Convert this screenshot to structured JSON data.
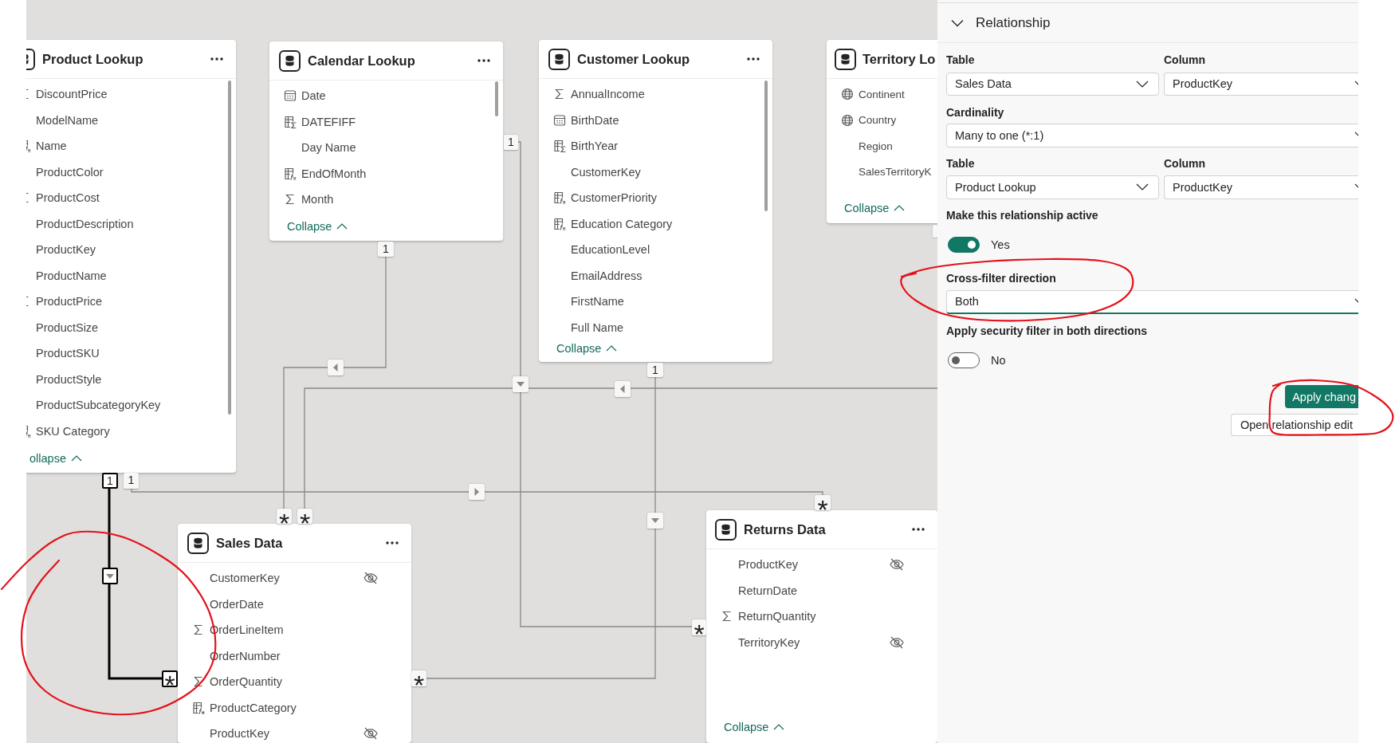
{
  "cards": [
    {
      "title": "Product Lookup",
      "fields": [
        {
          "name": "DiscountPrice",
          "kind": "sum",
          "hidden": false
        },
        {
          "name": "ModelName",
          "kind": "plain",
          "hidden": false
        },
        {
          "name": "Name",
          "kind": "calc",
          "hidden": false
        },
        {
          "name": "ProductColor",
          "kind": "plain",
          "hidden": false
        },
        {
          "name": "ProductCost",
          "kind": "sum",
          "hidden": false
        },
        {
          "name": "ProductDescription",
          "kind": "plain",
          "hidden": false
        },
        {
          "name": "ProductKey",
          "kind": "plain",
          "hidden": false
        },
        {
          "name": "ProductName",
          "kind": "plain",
          "hidden": false
        },
        {
          "name": "ProductPrice",
          "kind": "sum",
          "hidden": false
        },
        {
          "name": "ProductSize",
          "kind": "plain",
          "hidden": false
        },
        {
          "name": "ProductSKU",
          "kind": "plain",
          "hidden": false
        },
        {
          "name": "ProductStyle",
          "kind": "plain",
          "hidden": false
        },
        {
          "name": "ProductSubcategoryKey",
          "kind": "plain",
          "hidden": false
        },
        {
          "name": "SKU Category",
          "kind": "calc",
          "hidden": false
        }
      ],
      "collapse_label": "ollapse"
    },
    {
      "title": "Calendar Lookup",
      "fields": [
        {
          "name": "Date",
          "kind": "date",
          "hidden": false
        },
        {
          "name": "DATEFIFF",
          "kind": "calc_sum",
          "hidden": false
        },
        {
          "name": "Day Name",
          "kind": "plain",
          "hidden": false
        },
        {
          "name": "EndOfMonth",
          "kind": "calc",
          "hidden": false
        },
        {
          "name": "Month",
          "kind": "sum",
          "hidden": false
        }
      ],
      "collapse_label": "Collapse"
    },
    {
      "title": "Customer Lookup",
      "fields": [
        {
          "name": "AnnualIncome",
          "kind": "sum",
          "hidden": false
        },
        {
          "name": "BirthDate",
          "kind": "date",
          "hidden": false
        },
        {
          "name": "BirthYear",
          "kind": "calc_sum",
          "hidden": false
        },
        {
          "name": "CustomerKey",
          "kind": "plain",
          "hidden": false
        },
        {
          "name": "CustomerPriority",
          "kind": "calc",
          "hidden": false
        },
        {
          "name": "Education Category",
          "kind": "calc",
          "hidden": false
        },
        {
          "name": "EducationLevel",
          "kind": "plain",
          "hidden": false
        },
        {
          "name": "EmailAddress",
          "kind": "plain",
          "hidden": false
        },
        {
          "name": "FirstName",
          "kind": "plain",
          "hidden": false
        },
        {
          "name": "Full Name",
          "kind": "plain",
          "hidden": false
        }
      ],
      "collapse_label": "Collapse"
    },
    {
      "title": "Territory Lo",
      "fields": [
        {
          "name": "Continent",
          "kind": "geo",
          "hidden": false
        },
        {
          "name": "Country",
          "kind": "geo",
          "hidden": false
        },
        {
          "name": "Region",
          "kind": "plain",
          "hidden": false
        },
        {
          "name": "SalesTerritoryK",
          "kind": "plain",
          "hidden": false
        }
      ],
      "collapse_label": "Collapse"
    },
    {
      "title": "Sales Data",
      "fields": [
        {
          "name": "CustomerKey",
          "kind": "plain",
          "hidden": true
        },
        {
          "name": "OrderDate",
          "kind": "plain",
          "hidden": false
        },
        {
          "name": "OrderLineItem",
          "kind": "sum",
          "hidden": false
        },
        {
          "name": "OrderNumber",
          "kind": "plain",
          "hidden": false
        },
        {
          "name": "OrderQuantity",
          "kind": "sum",
          "hidden": false
        },
        {
          "name": "ProductCategory",
          "kind": "calc",
          "hidden": false
        },
        {
          "name": "ProductKey",
          "kind": "plain",
          "hidden": true
        }
      ]
    },
    {
      "title": "Returns Data",
      "fields": [
        {
          "name": "ProductKey",
          "kind": "plain",
          "hidden": true
        },
        {
          "name": "ReturnDate",
          "kind": "plain",
          "hidden": false
        },
        {
          "name": "ReturnQuantity",
          "kind": "sum",
          "hidden": false
        },
        {
          "name": "TerritoryKey",
          "kind": "plain",
          "hidden": true
        }
      ],
      "collapse_label": "Collapse"
    }
  ],
  "relationships": [
    {
      "one_end": "1",
      "many_end": "*",
      "selected": true
    },
    {
      "one_end": "1",
      "many_end": "*",
      "selected": false
    },
    {
      "one_end": "1",
      "many_end": "*",
      "selected": false
    },
    {
      "one_end": "1",
      "many_end": "*",
      "selected": false
    },
    {
      "one_end": "1",
      "many_end": "*",
      "selected": false
    },
    {
      "many_end": "*",
      "selected": false
    }
  ],
  "relationship_panel": {
    "title": "Relationship",
    "expanded": true,
    "from": {
      "table_label": "Table",
      "table": "Sales Data",
      "column_label": "Column",
      "column": "ProductKey"
    },
    "cardinality": {
      "label": "Cardinality",
      "value": "Many to one (*:1)"
    },
    "to": {
      "table_label": "Table",
      "table": "Product Lookup",
      "column_label": "Column",
      "column": "ProductKey"
    },
    "active": {
      "label": "Make this relationship active",
      "on": true,
      "state_label": "Yes"
    },
    "cross_filter": {
      "label": "Cross-filter direction",
      "value": "Both",
      "focused": true
    },
    "security_filter": {
      "label": "Apply security filter in both directions",
      "on": false,
      "state_label": "No"
    },
    "buttons": [
      {
        "label": "Apply chang",
        "kind": "primary"
      },
      {
        "label": "Open relationship edit",
        "kind": "secondary"
      }
    ]
  }
}
